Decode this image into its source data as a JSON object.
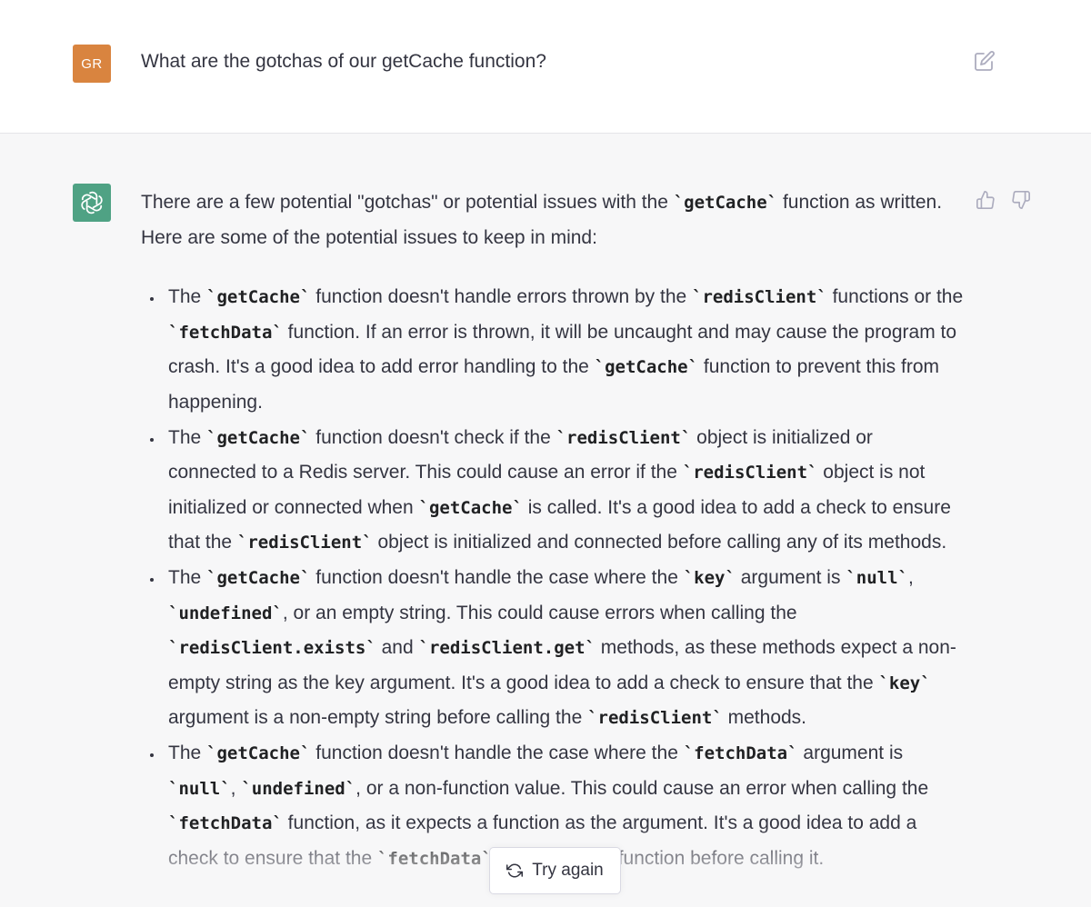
{
  "user_message": {
    "avatar_initials": "GR",
    "avatar_color": "#d9843f",
    "text": "What are the gotchas of our getCache function?",
    "edit_icon": "edit-icon"
  },
  "assistant_message": {
    "avatar_icon": "openai-logo-icon",
    "avatar_color": "#4fa284",
    "feedback_icons": [
      "thumbs-up-icon",
      "thumbs-down-icon"
    ],
    "intro": [
      {
        "t": "There are a few potential \"gotchas\" or potential issues with the "
      },
      {
        "c": "`getCache`"
      },
      {
        "t": " function as written. Here are some of the potential issues to keep in mind:"
      }
    ],
    "bullets": [
      [
        {
          "t": "The "
        },
        {
          "c": "`getCache`"
        },
        {
          "t": " function doesn't handle errors thrown by the "
        },
        {
          "c": "`redisClient`"
        },
        {
          "t": " functions or the "
        },
        {
          "c": "`fetchData`"
        },
        {
          "t": " function. If an error is thrown, it will be uncaught and may cause the program to crash. It's a good idea to add error handling to the "
        },
        {
          "c": "`getCache`"
        },
        {
          "t": " function to prevent this from happening."
        }
      ],
      [
        {
          "t": "The "
        },
        {
          "c": "`getCache`"
        },
        {
          "t": " function doesn't check if the "
        },
        {
          "c": "`redisClient`"
        },
        {
          "t": " object is initialized or connected to a Redis server. This could cause an error if the "
        },
        {
          "c": "`redisClient`"
        },
        {
          "t": " object is not initialized or connected when "
        },
        {
          "c": "`getCache`"
        },
        {
          "t": " is called. It's a good idea to add a check to ensure that the "
        },
        {
          "c": "`redisClient`"
        },
        {
          "t": " object is initialized and connected before calling any of its methods."
        }
      ],
      [
        {
          "t": "The "
        },
        {
          "c": "`getCache`"
        },
        {
          "t": " function doesn't handle the case where the "
        },
        {
          "c": "`key`"
        },
        {
          "t": " argument is "
        },
        {
          "c": "`null`"
        },
        {
          "t": ", "
        },
        {
          "c": "`undefined`"
        },
        {
          "t": ", or an empty string. This could cause errors when calling the "
        },
        {
          "c": "`redisClient.exists`"
        },
        {
          "t": " and "
        },
        {
          "c": "`redisClient.get`"
        },
        {
          "t": " methods, as these methods expect a non-empty string as the key argument. It's a good idea to add a check to ensure that the "
        },
        {
          "c": "`key`"
        },
        {
          "t": " argument is a non-empty string before calling the "
        },
        {
          "c": "`redisClient`"
        },
        {
          "t": " methods."
        }
      ],
      [
        {
          "t": "The "
        },
        {
          "c": "`getCache`"
        },
        {
          "t": " function doesn't handle the case where the "
        },
        {
          "c": "`fetchData`"
        },
        {
          "t": " argument is "
        },
        {
          "c": "`null`"
        },
        {
          "t": ", "
        },
        {
          "c": "`undefined`"
        },
        {
          "t": ", or a non-function value. This could cause an error when calling the "
        },
        {
          "c": "`fetchData`"
        },
        {
          "t": " function, as it expects a function as the argument. It's a good idea to add a check to ensure that the "
        },
        {
          "c": "`fetchData`"
        },
        {
          "t": " argument is a function before calling it."
        }
      ]
    ]
  },
  "try_again": {
    "icon": "refresh-icon",
    "label": "Try again"
  }
}
